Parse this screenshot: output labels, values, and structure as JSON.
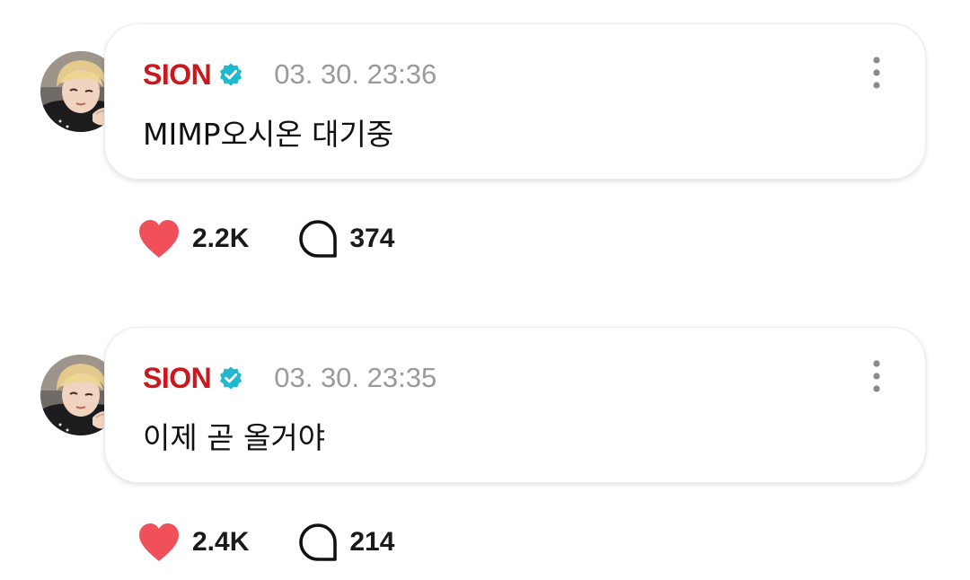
{
  "colors": {
    "author_name": "#c8191f",
    "verified_badge": "#1fb8cf",
    "like_heart": "#f0505a",
    "timestamp": "#9a9a9a"
  },
  "posts": [
    {
      "author": "SION",
      "verified_icon": "verified-badge-icon",
      "timestamp": "03. 30. 23:36",
      "text": "MIMP오시온 대기중",
      "likes": "2.2K",
      "comments": "374",
      "like_icon": "heart-icon",
      "comment_icon": "comment-bubble-icon",
      "more_icon": "more-vertical-icon"
    },
    {
      "author": "SION",
      "verified_icon": "verified-badge-icon",
      "timestamp": "03. 30. 23:35",
      "text": "이제 곧 올거야",
      "likes": "2.4K",
      "comments": "214",
      "like_icon": "heart-icon",
      "comment_icon": "comment-bubble-icon",
      "more_icon": "more-vertical-icon"
    }
  ]
}
